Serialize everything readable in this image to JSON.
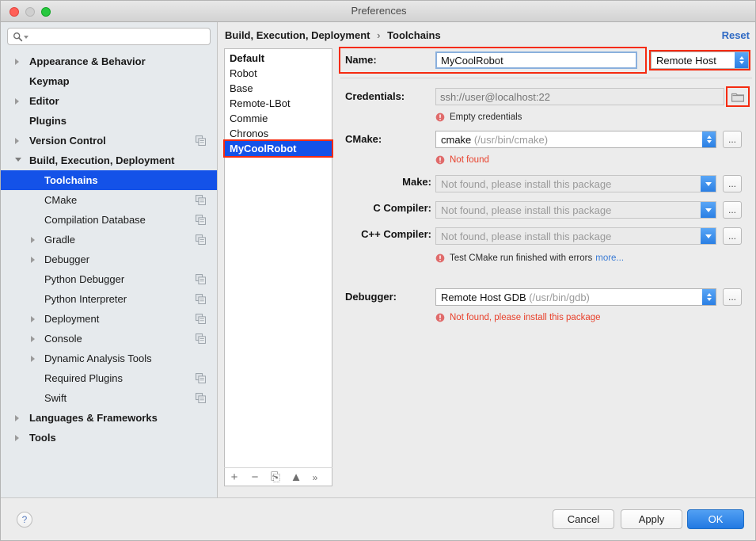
{
  "window": {
    "title": "Preferences",
    "traffic_lights": [
      "close-button",
      "minimize-button",
      "maximize-button"
    ]
  },
  "sidebar": {
    "search": {
      "value": "",
      "placeholder": "",
      "icon": "search-icon"
    },
    "items": [
      {
        "label": "Appearance & Behavior",
        "depth": 0,
        "twisty": "right",
        "bold": true,
        "selected": false,
        "copy": false
      },
      {
        "label": "Keymap",
        "depth": 0,
        "twisty": "none",
        "bold": true,
        "selected": false,
        "copy": false
      },
      {
        "label": "Editor",
        "depth": 0,
        "twisty": "right",
        "bold": true,
        "selected": false,
        "copy": false
      },
      {
        "label": "Plugins",
        "depth": 0,
        "twisty": "none",
        "bold": true,
        "selected": false,
        "copy": false
      },
      {
        "label": "Version Control",
        "depth": 0,
        "twisty": "right",
        "bold": true,
        "selected": false,
        "copy": true
      },
      {
        "label": "Build, Execution, Deployment",
        "depth": 0,
        "twisty": "down",
        "bold": true,
        "selected": false,
        "copy": false
      },
      {
        "label": "Toolchains",
        "depth": 1,
        "twisty": "none",
        "bold": false,
        "selected": true,
        "copy": false
      },
      {
        "label": "CMake",
        "depth": 1,
        "twisty": "none",
        "bold": false,
        "selected": false,
        "copy": true
      },
      {
        "label": "Compilation Database",
        "depth": 1,
        "twisty": "none",
        "bold": false,
        "selected": false,
        "copy": true
      },
      {
        "label": "Gradle",
        "depth": 1,
        "twisty": "right",
        "bold": false,
        "selected": false,
        "copy": true
      },
      {
        "label": "Debugger",
        "depth": 1,
        "twisty": "right",
        "bold": false,
        "selected": false,
        "copy": false
      },
      {
        "label": "Python Debugger",
        "depth": 1,
        "twisty": "none",
        "bold": false,
        "selected": false,
        "copy": true
      },
      {
        "label": "Python Interpreter",
        "depth": 1,
        "twisty": "none",
        "bold": false,
        "selected": false,
        "copy": true
      },
      {
        "label": "Deployment",
        "depth": 1,
        "twisty": "right",
        "bold": false,
        "selected": false,
        "copy": true
      },
      {
        "label": "Console",
        "depth": 1,
        "twisty": "right",
        "bold": false,
        "selected": false,
        "copy": true
      },
      {
        "label": "Dynamic Analysis Tools",
        "depth": 1,
        "twisty": "right",
        "bold": false,
        "selected": false,
        "copy": false
      },
      {
        "label": "Required Plugins",
        "depth": 1,
        "twisty": "none",
        "bold": false,
        "selected": false,
        "copy": true
      },
      {
        "label": "Swift",
        "depth": 1,
        "twisty": "none",
        "bold": false,
        "selected": false,
        "copy": true
      },
      {
        "label": "Languages & Frameworks",
        "depth": 0,
        "twisty": "right",
        "bold": true,
        "selected": false,
        "copy": false
      },
      {
        "label": "Tools",
        "depth": 0,
        "twisty": "right",
        "bold": true,
        "selected": false,
        "copy": false
      }
    ]
  },
  "main": {
    "breadcrumb": {
      "parent": "Build, Execution, Deployment",
      "separator": "›",
      "current": "Toolchains"
    },
    "reset_label": "Reset",
    "toolchain_list": {
      "items": [
        {
          "label": "Default",
          "bold": true,
          "selected": false,
          "highlighted": false
        },
        {
          "label": "Robot",
          "bold": false,
          "selected": false,
          "highlighted": false
        },
        {
          "label": "Base",
          "bold": false,
          "selected": false,
          "highlighted": false
        },
        {
          "label": "Remote-LBot",
          "bold": false,
          "selected": false,
          "highlighted": false
        },
        {
          "label": "Commie",
          "bold": false,
          "selected": false,
          "highlighted": false
        },
        {
          "label": "Chronos",
          "bold": false,
          "selected": false,
          "highlighted": false
        },
        {
          "label": "MyCoolRobot",
          "bold": false,
          "selected": true,
          "highlighted": true
        }
      ],
      "toolbar": [
        {
          "name": "add-toolchain-button",
          "glyph": "+"
        },
        {
          "name": "remove-toolchain-button",
          "glyph": "−"
        },
        {
          "name": "copy-toolchain-button",
          "glyph": "⎘"
        },
        {
          "name": "move-up-button",
          "glyph": "▲"
        },
        {
          "name": "overflow-button",
          "glyph": "»"
        }
      ]
    },
    "form": {
      "name": {
        "label": "Name:",
        "value": "MyCoolRobot",
        "placeholder": "",
        "highlighted": true
      },
      "type": {
        "value": "Remote Host",
        "control": "stepper",
        "highlighted": true
      },
      "credentials": {
        "label": "Credentials:",
        "value": "",
        "placeholder": "ssh://user@localhost:22",
        "browse_icon": "folder-icon",
        "browse_highlighted": true,
        "error": {
          "text": "Empty credentials",
          "style": "dark",
          "icon": "error-icon"
        }
      },
      "cmake": {
        "label": "CMake:",
        "value": "cmake",
        "value_path": "(/usr/bin/cmake)",
        "control": "stepper",
        "disabled": false,
        "error": {
          "text": "Not found",
          "style": "red",
          "icon": "error-icon"
        }
      },
      "make": {
        "label": "Make:",
        "value": "",
        "placeholder": "Not found, please install this package",
        "control": "chevron",
        "disabled": true
      },
      "c_compiler": {
        "label": "C Compiler:",
        "value": "",
        "placeholder": "Not found, please install this package",
        "control": "chevron",
        "disabled": true
      },
      "cpp_compiler": {
        "label": "C++ Compiler:",
        "value": "",
        "placeholder": "Not found, please install this package",
        "control": "chevron",
        "disabled": true,
        "error": {
          "text": "Test CMake run finished with errors",
          "link": "more...",
          "style": "dark",
          "icon": "error-icon"
        }
      },
      "debugger": {
        "label": "Debugger:",
        "value": "Remote Host GDB",
        "value_path": "(/usr/bin/gdb)",
        "control": "stepper",
        "disabled": false,
        "error": {
          "text": "Not found, please install this package",
          "style": "red",
          "icon": "error-icon"
        }
      },
      "ellipsis_label": "..."
    }
  },
  "bottom": {
    "help_label": "?",
    "cancel_label": "Cancel",
    "apply_label": "Apply",
    "ok_label": "OK"
  },
  "colors": {
    "selection_blue": "#1452e8",
    "highlight_red": "#f52b10",
    "link_blue": "#2f6ac4",
    "error_red": "#e8412c",
    "accent_button_blue": "#2279e2"
  }
}
